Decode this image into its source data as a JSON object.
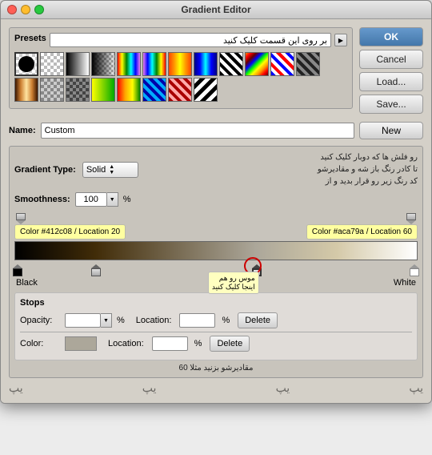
{
  "window": {
    "title": "Gradient Editor"
  },
  "presets": {
    "label": "Presets",
    "input_value": "بر روی این قسمت کلیک کنید",
    "placeholder": "بر روی این قسمت کلیک کنید"
  },
  "buttons": {
    "ok": "OK",
    "cancel": "Cancel",
    "load": "Load...",
    "save": "Save...",
    "new": "New",
    "delete1": "Delete",
    "delete2": "Delete"
  },
  "name": {
    "label": "Name:",
    "value": "Custom"
  },
  "gradient_type": {
    "label": "Gradient Type:",
    "value": "Solid"
  },
  "smoothness": {
    "label": "Smoothness:",
    "value": "100",
    "unit": "%"
  },
  "stops": {
    "title": "Stops",
    "opacity_label": "Opacity:",
    "opacity_value": "",
    "opacity_unit": "%",
    "opacity_location_label": "Location:",
    "opacity_location_value": "",
    "color_label": "Color:",
    "color_location_label": "Location:",
    "color_location_value": "",
    "color_location_unit": "%"
  },
  "color_bubbles": {
    "left": "Color #412c08 / Location 20",
    "right": "Color #aca79a / Location 60"
  },
  "annotations": {
    "top_rtl": "رو فلش ها که دوبار کلیک کنید\nتا کادر رنگ باز شه و مقادیرشو\nکد رنگ زیر رو قرار بدید و از",
    "bottom_rtl": "مقادیرشو بزنید مثلا 60",
    "mouse_tooltip_rtl": "موس رو هم\nاینجا کلیک کنید",
    "black_label": "Black",
    "white_label": "White"
  },
  "icons": {
    "arrow_right": "▶",
    "arrow_down": "▼",
    "arrow_up": "▲"
  }
}
